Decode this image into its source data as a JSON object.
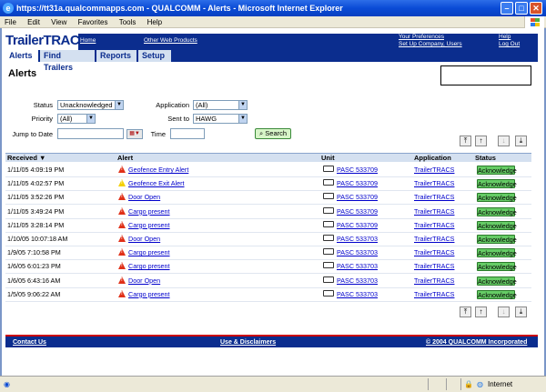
{
  "window": {
    "title": "https://tt31a.qualcommapps.com - QUALCOMM - Alerts - Microsoft Internet Explorer",
    "menu": [
      "File",
      "Edit",
      "View",
      "Favorites",
      "Tools",
      "Help"
    ]
  },
  "header": {
    "logo": "TrailerTRACS",
    "logo_mark": "®",
    "home": "Home",
    "other_web_products": "Other Web Products",
    "your_preferences": "Your Preferences",
    "setup_company_users": "Set Up Company, Users",
    "help": "Help",
    "logout": "Log Out"
  },
  "nav": {
    "tabs": [
      "Alerts",
      "Find Trailers",
      "Reports",
      "Setup"
    ],
    "active": "Alerts"
  },
  "page": {
    "title": "Alerts"
  },
  "filters": {
    "status_label": "Status",
    "status_value": "Unacknowledged",
    "application_label": "Application",
    "application_value": "(All)",
    "priority_label": "Priority",
    "priority_value": "(All)",
    "sent_to_label": "Sent to",
    "sent_to_value": "HAWG",
    "jump_to_date_label": "Jump to Date",
    "jump_to_date_value": "",
    "time_label": "Time",
    "time_value": "",
    "search_label": "Search"
  },
  "table": {
    "headers": {
      "received": "Received ▼",
      "alert": "Alert",
      "unit": "Unit",
      "application": "Application",
      "status": "Status"
    },
    "rows": [
      {
        "received": "1/11/05 4:09:19 PM",
        "alert": "Geofence Entry Alert",
        "severity": "red",
        "unit": "PASC 533709",
        "application": "TrailerTRACS",
        "status": "Acknowledge"
      },
      {
        "received": "1/11/05 4:02:57 PM",
        "alert": "Geofence Exit Alert",
        "severity": "yellow",
        "unit": "PASC 533709",
        "application": "TrailerTRACS",
        "status": "Acknowledge"
      },
      {
        "received": "1/11/05 3:52:26 PM",
        "alert": "Door Open",
        "severity": "red",
        "unit": "PASC 533709",
        "application": "TrailerTRACS",
        "status": "Acknowledge"
      },
      {
        "received": "1/11/05 3:49:24 PM",
        "alert": "Cargo present",
        "severity": "red",
        "unit": "PASC 533709",
        "application": "TrailerTRACS",
        "status": "Acknowledge"
      },
      {
        "received": "1/11/05 3:28:14 PM",
        "alert": "Cargo present",
        "severity": "red",
        "unit": "PASC 533709",
        "application": "TrailerTRACS",
        "status": "Acknowledge"
      },
      {
        "received": "1/10/05 10:07:18 AM",
        "alert": "Door Open",
        "severity": "red",
        "unit": "PASC 533703",
        "application": "TrailerTRACS",
        "status": "Acknowledge"
      },
      {
        "received": "1/9/05 7:10:58 PM",
        "alert": "Cargo present",
        "severity": "red",
        "unit": "PASC 533703",
        "application": "TrailerTRACS",
        "status": "Acknowledge"
      },
      {
        "received": "1/6/05 6:01:23 PM",
        "alert": "Cargo present",
        "severity": "red",
        "unit": "PASC 533703",
        "application": "TrailerTRACS",
        "status": "Acknowledge"
      },
      {
        "received": "1/6/05 6:43:16 AM",
        "alert": "Door Open",
        "severity": "red",
        "unit": "PASC 533703",
        "application": "TrailerTRACS",
        "status": "Acknowledge"
      },
      {
        "received": "1/5/05 9:06:22 AM",
        "alert": "Cargo present",
        "severity": "red",
        "unit": "PASC 533703",
        "application": "TrailerTRACS",
        "status": "Acknowledge"
      }
    ]
  },
  "footer": {
    "contact_us": "Contact Us",
    "use_disclaimers": "Use & Disclaimers",
    "copyright": "© 2004 QUALCOMM Incorporated"
  },
  "statusbar": {
    "zone": "Internet"
  },
  "colors": {
    "brand_navy": "#0b2d8e",
    "nav_light": "#d4e0f0",
    "ack_green": "#66cc66",
    "alert_red": "#e03018",
    "alert_yellow": "#f4d000"
  }
}
